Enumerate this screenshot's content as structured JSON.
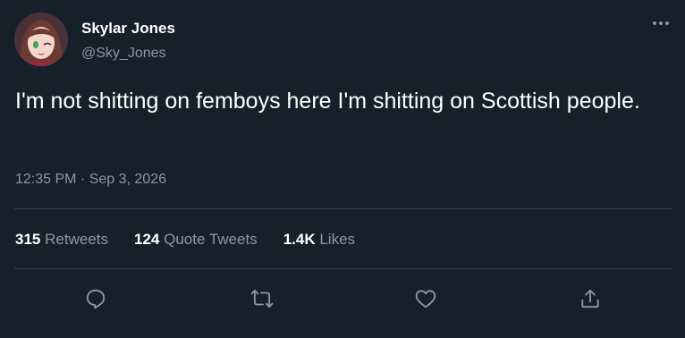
{
  "user": {
    "display_name": "Skylar Jones",
    "handle": "@Sky_Jones",
    "avatar_icon": "anime-girl-avatar"
  },
  "more_icon": "ellipsis-icon",
  "tweet": {
    "text": "I'm not shitting on femboys here I'm shitting on Scottish people.",
    "timestamp": "12:35 PM · Sep 3, 2026"
  },
  "stats": {
    "retweets": {
      "count": "315",
      "label": "Retweets"
    },
    "quote_tweets": {
      "count": "124",
      "label": "Quote Tweets"
    },
    "likes": {
      "count": "1.4K",
      "label": "Likes"
    }
  },
  "actions": [
    "reply-icon",
    "retweet-icon",
    "like-icon",
    "share-icon"
  ],
  "colors": {
    "background": "#15202b",
    "text": "#ffffff",
    "secondary_text": "#8b98a5",
    "divider": "#38444d"
  }
}
